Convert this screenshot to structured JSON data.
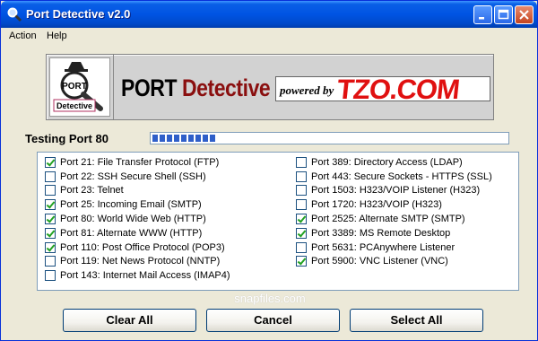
{
  "window": {
    "title": "Port Detective v2.0",
    "controls": {
      "minimize": "minimize",
      "maximize": "maximize",
      "close": "close"
    }
  },
  "menu": [
    {
      "label": "Action"
    },
    {
      "label": "Help"
    }
  ],
  "banner": {
    "logo_text": "PORT",
    "logo_subtext": "Detective",
    "brand_part1": "PORT ",
    "brand_part2": "Detective",
    "powered_by": "powered by",
    "tzo": "TZO.COM"
  },
  "status": {
    "testing_label": "Testing Port 80",
    "progress_fraction": 0.2
  },
  "ports_left": [
    {
      "label": "Port 21: File Transfer Protocol (FTP)",
      "checked": true
    },
    {
      "label": "Port 22: SSH Secure Shell (SSH)",
      "checked": false
    },
    {
      "label": "Port 23: Telnet",
      "checked": false
    },
    {
      "label": "Port 25: Incoming Email (SMTP)",
      "checked": true
    },
    {
      "label": "Port 80: World Wide Web (HTTP)",
      "checked": true
    },
    {
      "label": "Port 81: Alternate WWW (HTTP)",
      "checked": true
    },
    {
      "label": "Port 110: Post Office Protocol (POP3)",
      "checked": true
    },
    {
      "label": "Port 119: Net News Protocol (NNTP)",
      "checked": false
    },
    {
      "label": "Port 143: Internet Mail Access (IMAP4)",
      "checked": false
    }
  ],
  "ports_right": [
    {
      "label": "Port 389: Directory Access (LDAP)",
      "checked": false
    },
    {
      "label": "Port 443: Secure Sockets - HTTPS (SSL)",
      "checked": false
    },
    {
      "label": "Port 1503: H323/VOIP Listener (H323)",
      "checked": false
    },
    {
      "label": "Port 1720: H323/VOIP (H323)",
      "checked": false
    },
    {
      "label": "Port 2525: Alternate SMTP (SMTP)",
      "checked": true
    },
    {
      "label": "Port 3389: MS Remote Desktop",
      "checked": true
    },
    {
      "label": "Port 5631: PCAnywhere Listener",
      "checked": false
    },
    {
      "label": "Port 5900: VNC Listener (VNC)",
      "checked": true
    }
  ],
  "watermark": "snapfiles.com",
  "buttons": {
    "clear_all": "Clear All",
    "cancel": "Cancel",
    "select_all": "Select All"
  }
}
